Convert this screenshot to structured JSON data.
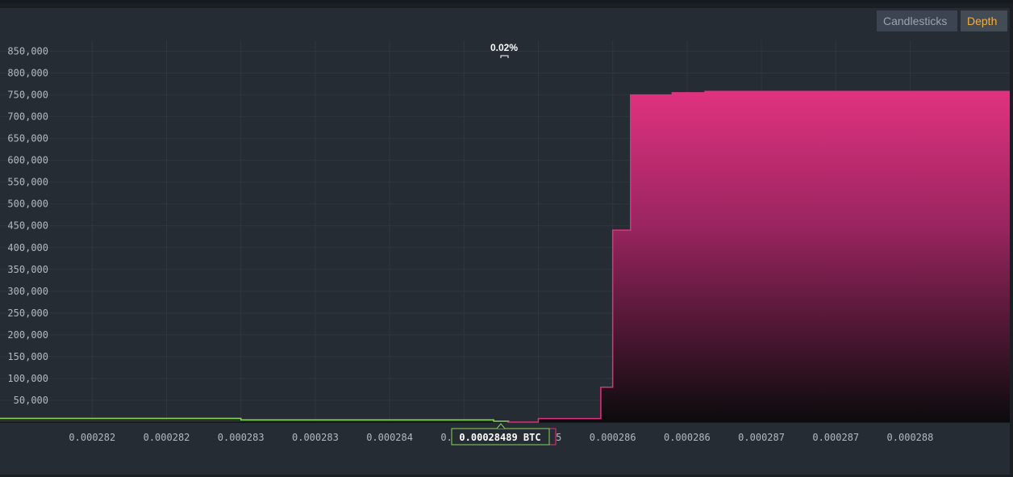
{
  "toolbar": {
    "candlesticks_label": "Candlesticks",
    "depth_label": "Depth"
  },
  "colors": {
    "bid": "#8bd35a",
    "ask": "#e0327f",
    "active_tab": "#f0b03c"
  },
  "chart_data": {
    "type": "area",
    "subtype": "depth",
    "spread_label": "0.02%",
    "mid_price_label": "0.00028489 BTC",
    "ylim": [
      0,
      875000
    ],
    "xlim": [
      0.00028148,
      0.00028827
    ],
    "y_ticks": [
      "850,000",
      "800,000",
      "750,000",
      "700,000",
      "650,000",
      "600,000",
      "550,000",
      "500,000",
      "450,000",
      "400,000",
      "350,000",
      "300,000",
      "250,000",
      "200,000",
      "150,000",
      "100,000",
      "50,000"
    ],
    "y_tick_values": [
      850000,
      800000,
      750000,
      700000,
      650000,
      600000,
      550000,
      500000,
      450000,
      400000,
      350000,
      300000,
      250000,
      200000,
      150000,
      100000,
      50000
    ],
    "x_ticks": [
      "0.000282",
      "0.000282",
      "0.000283",
      "0.000283",
      "0.000284",
      "0.000285",
      "0.000285",
      "0.000286",
      "0.000286",
      "0.000287",
      "0.000287",
      "0.000288"
    ],
    "x_tick_values": [
      0.0002821,
      0.0002826,
      0.0002831,
      0.0002836,
      0.0002841,
      0.0002846,
      0.0002851,
      0.0002856,
      0.0002861,
      0.0002866,
      0.0002871,
      0.0002876
    ],
    "grid": true,
    "series": [
      {
        "side": "bid",
        "x": [
          0.00028148,
          0.000283,
          0.0002831,
          0.0002841,
          0.0002848,
          0.0002849
        ],
        "y": [
          8500,
          8500,
          5000,
          5000,
          2000,
          0
        ]
      },
      {
        "side": "ask",
        "x": [
          0.00028489,
          0.0002851,
          0.0002852,
          0.0002855,
          0.00028552,
          0.0002856,
          0.0002857,
          0.00028572,
          0.0002858,
          0.000286,
          0.00028622,
          0.00028827
        ],
        "y": [
          0,
          8000,
          8000,
          8000,
          80000,
          440000,
          440000,
          750000,
          750000,
          755000,
          758000,
          758000
        ]
      }
    ]
  }
}
